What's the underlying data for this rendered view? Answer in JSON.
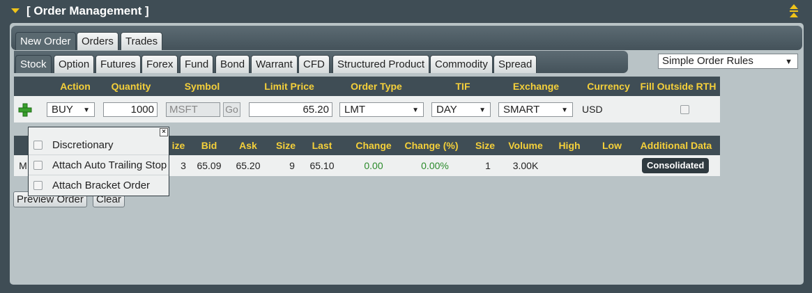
{
  "header": {
    "title": "[ Order Management ]"
  },
  "outer_tabs": [
    {
      "label": "New Order",
      "active": true
    },
    {
      "label": "Orders",
      "active": false
    },
    {
      "label": "Trades",
      "active": false
    }
  ],
  "inner_tabs": [
    {
      "label": "Stock",
      "active": true
    },
    {
      "label": "Option",
      "active": false
    },
    {
      "label": "Futures",
      "active": false
    },
    {
      "label": "Forex",
      "active": false
    },
    {
      "label": "Fund",
      "active": false
    },
    {
      "label": "Bond",
      "active": false
    },
    {
      "label": "Warrant",
      "active": false
    },
    {
      "label": "CFD",
      "active": false
    },
    {
      "label": "Structured Product",
      "active": false
    },
    {
      "label": "Commodity",
      "active": false
    },
    {
      "label": "Spread",
      "active": false
    }
  ],
  "order_rules": {
    "selected": "Simple Order Rules"
  },
  "entry": {
    "headers": {
      "action": "Action",
      "quantity": "Quantity",
      "symbol": "Symbol",
      "limit_price": "Limit Price",
      "order_type": "Order Type",
      "tif": "TIF",
      "exchange": "Exchange",
      "currency": "Currency",
      "fill_outside_rth": "Fill Outside RTH"
    },
    "values": {
      "action": "BUY",
      "quantity": "1000",
      "symbol": "MSFT",
      "go": "Go",
      "limit_price": "65.20",
      "order_type": "LMT",
      "tif": "DAY",
      "exchange": "SMART",
      "currency": "USD"
    }
  },
  "market_data": {
    "headers": {
      "bid_size": "ize",
      "bid": "Bid",
      "ask": "Ask",
      "ask_size": "Size",
      "last": "Last",
      "change": "Change",
      "change_pct": "Change (%)",
      "last_size": "Size",
      "volume": "Volume",
      "high": "High",
      "low": "Low",
      "additional": "Additional Data"
    },
    "row": {
      "partial": "M",
      "bid_size": "3",
      "bid": "65.09",
      "ask": "65.20",
      "ask_size": "9",
      "last": "65.10",
      "change": "0.00",
      "change_pct": "0.00%",
      "last_size": "1",
      "volume": "3.00K",
      "high": "",
      "low": "",
      "additional": "Consolidated"
    }
  },
  "buttons": {
    "preview": "Preview Order",
    "clear": "Clear"
  },
  "popup": {
    "close": "×",
    "items": [
      "Discretionary",
      "Attach Auto Trailing Stop",
      "Attach Bracket Order"
    ]
  },
  "colors": {
    "header_bg": "#3f4d55",
    "header_text": "#f5d03a",
    "accent": "#f0c419",
    "positive": "#2a8a2a"
  }
}
